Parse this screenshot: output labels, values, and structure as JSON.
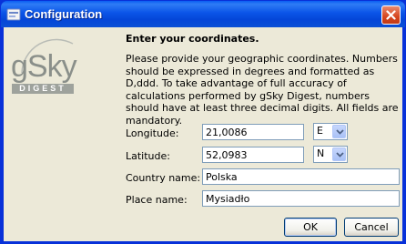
{
  "window": {
    "title": "Configuration"
  },
  "logo": {
    "brand": "gSky",
    "sub": "DIGEST"
  },
  "content": {
    "heading": "Enter your coordinates.",
    "description": "Please provide your geographic coordinates. Numbers should be expressed in degrees and formatted as D,ddd. To take advantage of full accuracy of calculations performed by gSky Digest, numbers should have at least three decimal digits. All fields are mandatory."
  },
  "fields": {
    "longitude": {
      "label": "Longitude:",
      "value": "21,0086",
      "direction": "E"
    },
    "latitude": {
      "label": "Latitude:",
      "value": "52,0983",
      "direction": "N"
    },
    "country": {
      "label": "Country name:",
      "value": "Polska"
    },
    "place": {
      "label": "Place name:",
      "value": "Mysiadło"
    }
  },
  "buttons": {
    "ok": "OK",
    "cancel": "Cancel"
  },
  "icons": {
    "title": "app-icon",
    "close": "close-icon",
    "dropdown": "chevron-down-icon"
  }
}
